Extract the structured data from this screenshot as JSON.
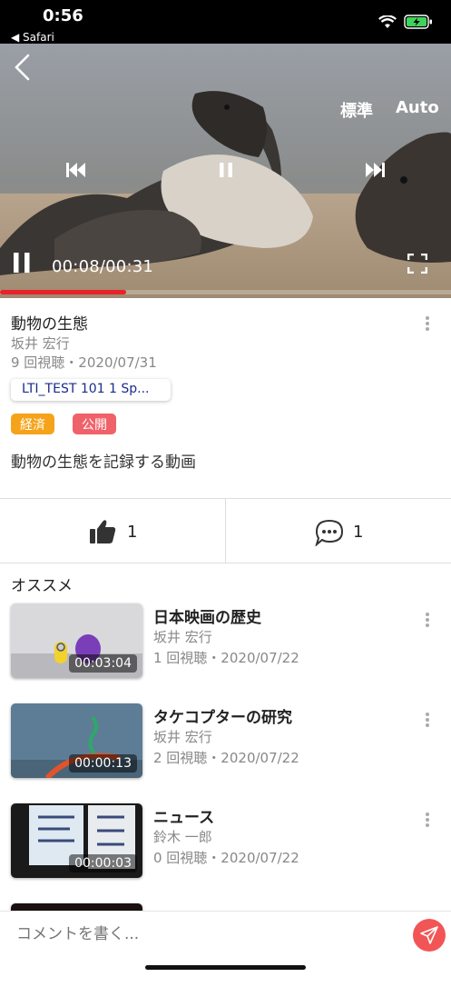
{
  "status": {
    "time": "0:56",
    "back_app": "◀ Safari"
  },
  "player": {
    "quality_label": "標準",
    "auto_label": "Auto",
    "time_display": "00:08/00:31",
    "progress": 0.28
  },
  "video": {
    "title": "動物の生態",
    "author": "坂井 宏行",
    "views": "9 回視聴・2020/07/31",
    "course": "LTI_TEST 101 1 Sp...",
    "tags": [
      {
        "label": "経済",
        "color": "#f5a31a"
      },
      {
        "label": "公開",
        "color": "#f0626a"
      }
    ],
    "description": "動物の生態を記録する動画"
  },
  "reactions": {
    "likes": "1",
    "comments": "1"
  },
  "recommend": {
    "heading": "オススメ",
    "items": [
      {
        "title": "日本映画の歴史",
        "author": "坂井 宏行",
        "views": "1 回視聴・2020/07/22",
        "duration": "00:03:04"
      },
      {
        "title": "タケコプターの研究",
        "author": "坂井 宏行",
        "views": "2 回視聴・2020/07/22",
        "duration": "00:00:13"
      },
      {
        "title": "ニュース",
        "author": "鈴木 一郎",
        "views": "0 回視聴・2020/07/22",
        "duration": "00:00:03"
      }
    ]
  },
  "comment": {
    "placeholder": "コメントを書く..."
  },
  "colors": {
    "accent_red": "#e8232a",
    "send_button": "#f25555",
    "course_text": "#1a2b8f"
  }
}
